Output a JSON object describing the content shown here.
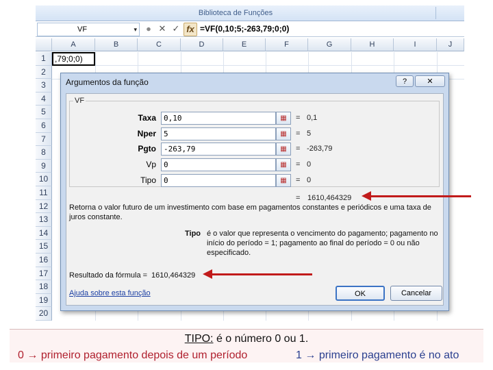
{
  "ribbon": {
    "group_label": "Biblioteca de Funções"
  },
  "formula_bar": {
    "name_box": "VF",
    "name_box_arrow": "▾",
    "cancel_icon": "✕",
    "enter_icon": "✓",
    "fx_label": "fx",
    "formula": "=VF(0,10;5;-263,79;0;0)"
  },
  "grid": {
    "columns": [
      "A",
      "B",
      "C",
      "D",
      "E",
      "F",
      "G",
      "H",
      "I",
      "J"
    ],
    "rows": [
      "1",
      "2",
      "3",
      "4",
      "5",
      "6",
      "7",
      "8",
      "9",
      "10",
      "11",
      "12",
      "13",
      "14",
      "15",
      "16",
      "17",
      "18",
      "19",
      "20"
    ],
    "cell_a1": ",79;0;0)"
  },
  "dialog": {
    "title": "Argumentos da função",
    "help_button": "?",
    "close_button": "✕",
    "function_name": "VF",
    "args": [
      {
        "label": "Taxa",
        "value": "0,10",
        "result": "0,1",
        "bold": true
      },
      {
        "label": "Nper",
        "value": "5",
        "result": "5",
        "bold": true
      },
      {
        "label": "Pgto",
        "value": "-263,79",
        "result": "-263,79",
        "bold": true
      },
      {
        "label": "Vp",
        "value": "0",
        "result": "0",
        "bold": false
      },
      {
        "label": "Tipo",
        "value": "0",
        "result": "0",
        "bold": false
      }
    ],
    "equals": "=",
    "overall_result": "1610,464329",
    "description": "Retorna o valor futuro de um investimento com base em pagamentos constantes e periódicos e uma taxa de juros constante.",
    "arg_help_label": "Tipo",
    "arg_help_text": "é o valor que representa o vencimento do pagamento; pagamento no início do período = 1; pagamento ao final do período = 0 ou não especificado.",
    "formula_result_label": "Resultado da fórmula =",
    "formula_result_value": "1610,464329",
    "help_link": "Ajuda sobre esta função",
    "ok_button": "OK",
    "cancel_button": "Cancelar"
  },
  "caption": {
    "line1_label": "TIPO:",
    "line1_text": "é o número 0 ou 1.",
    "left_number": "0",
    "left_text": "primeiro pagamento depois de um período",
    "right_number": "1",
    "right_text": "primeiro pagamento é no ato",
    "arrow_glyph": "→"
  },
  "colors": {
    "annotation_arrow": "#c11b1b",
    "caption_left": "#b0202e",
    "caption_right": "#2a3f8f",
    "dialog_bg": "#c9d9ee"
  }
}
